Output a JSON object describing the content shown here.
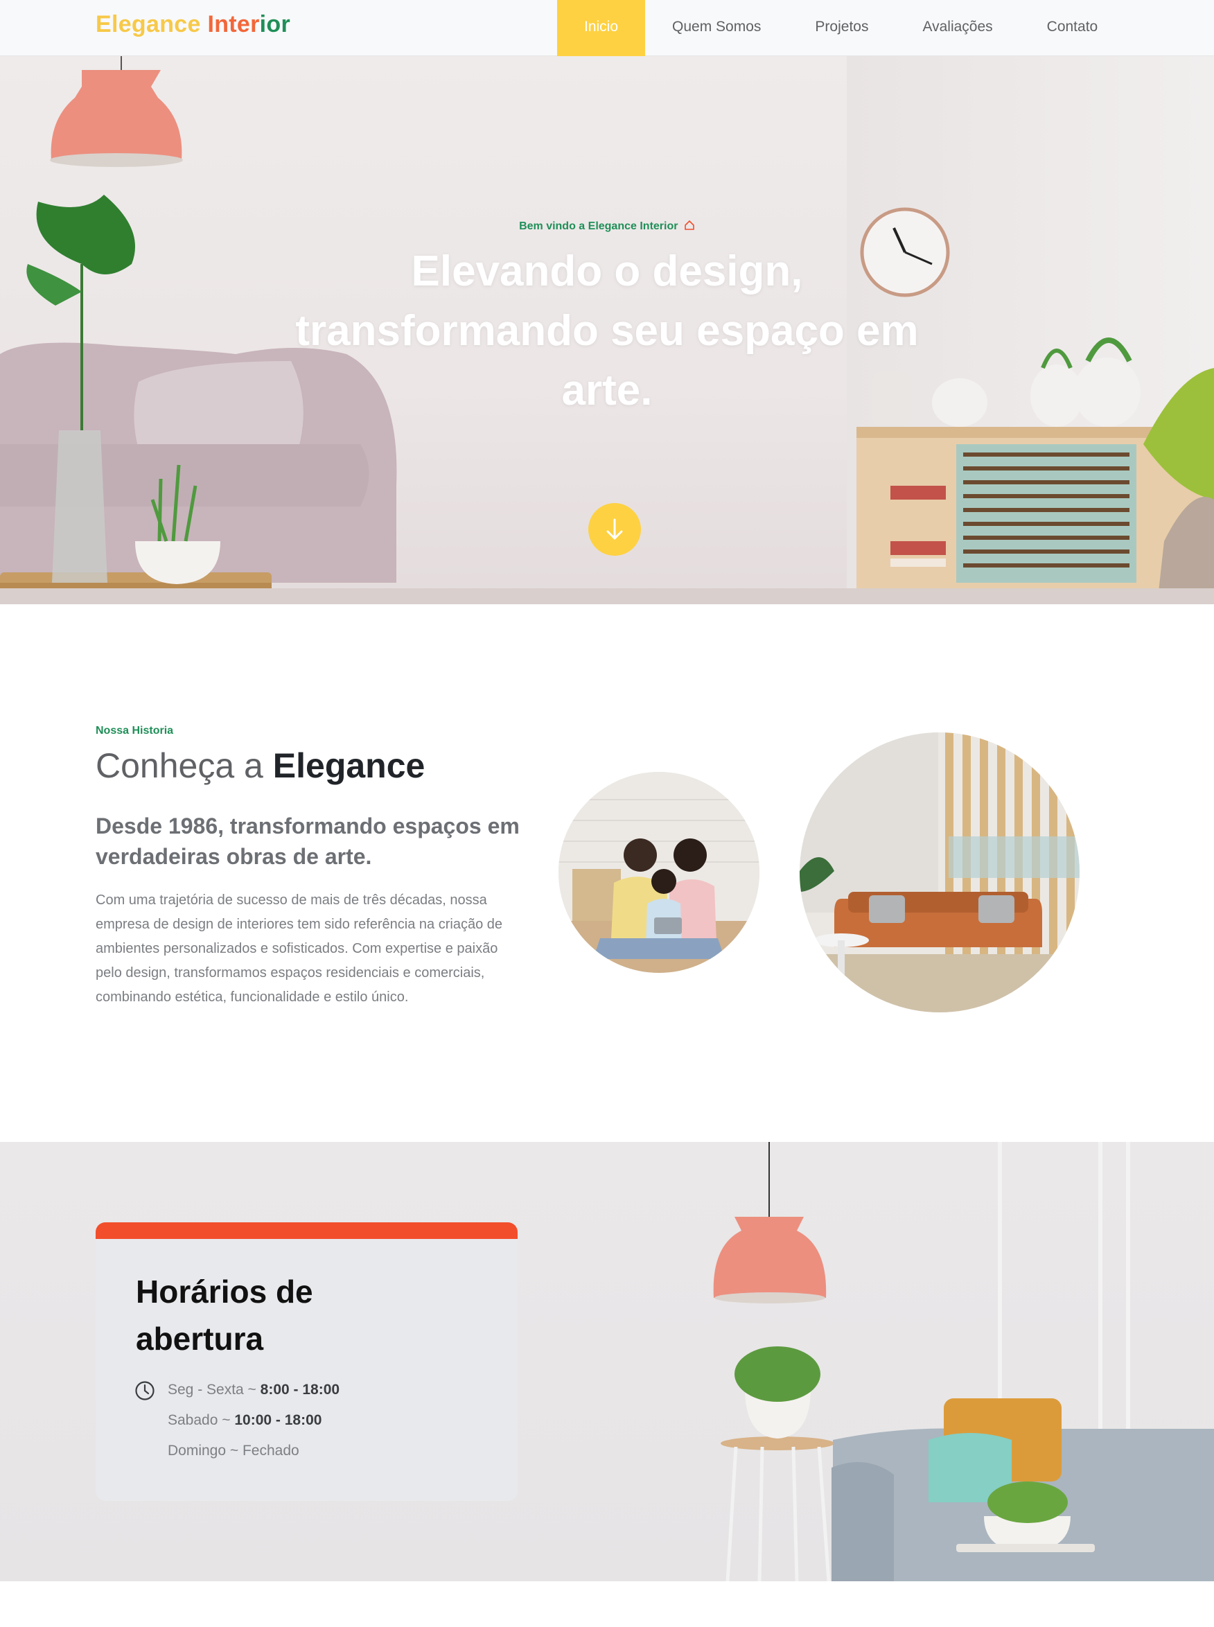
{
  "brand": {
    "logo_part1": "Elegance",
    "logo_part2": "Inter",
    "logo_part3": "ior"
  },
  "nav": {
    "items": [
      {
        "label": "Inicio",
        "active": true
      },
      {
        "label": "Quem Somos",
        "active": false
      },
      {
        "label": "Projetos",
        "active": false
      },
      {
        "label": "Avaliações",
        "active": false
      },
      {
        "label": "Contato",
        "active": false
      }
    ]
  },
  "hero": {
    "kicker": "Bem vindo a Elegance Interior",
    "title": "Elevando o design, transformando seu espaço em arte.",
    "scroll_icon": "arrow-down-icon"
  },
  "about": {
    "kicker": "Nossa Historia",
    "title_light": "Conheça a",
    "title_bold": "Elegance",
    "subtitle": "Desde 1986, transformando espaços em verdadeiras obras de arte.",
    "body": "Com uma trajetória de sucesso de mais de três décadas, nossa empresa de design de interiores tem sido referência na criação de ambientes personalizados e sofisticados. Com expertise e paixão pelo design, transformamos espaços residenciais e comerciais, combinando estética, funcionalidade e estilo único."
  },
  "hours": {
    "title": "Horários de abertura",
    "rows": [
      {
        "day": "Seg - Sexta ~",
        "time": "8:00 - 18:00"
      },
      {
        "day": "Sabado ~",
        "time": "10:00 - 18:00"
      },
      {
        "day": "Domingo ~ Fechado",
        "time": ""
      }
    ]
  },
  "colors": {
    "yellow": "#fdd142",
    "orange": "#f2673a",
    "green": "#1f8f58",
    "red_bar": "#f24e2b"
  }
}
